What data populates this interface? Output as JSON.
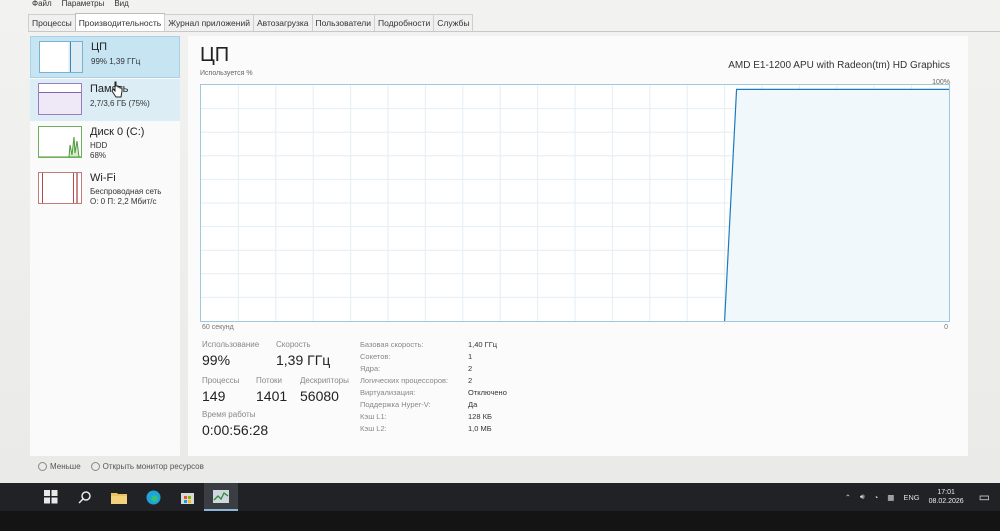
{
  "menu": [
    "Файл",
    "Параметры",
    "Вид"
  ],
  "tabs": [
    "Процессы",
    "Производительность",
    "Журнал приложений",
    "Автозагрузка",
    "Пользователи",
    "Подробности",
    "Службы"
  ],
  "active_tab": "Производительность",
  "sidebar": {
    "items": [
      {
        "title": "ЦП",
        "line1": "99% 1,39 ГГц",
        "line2": ""
      },
      {
        "title": "Память",
        "line1": "2,7/3,6 ГБ (75%)",
        "line2": ""
      },
      {
        "title": "Диск 0 (C:)",
        "line1": "HDD",
        "line2": "68%"
      },
      {
        "title": "Wi-Fi",
        "line1": "Беспроводная сеть",
        "line2": "О: 0 П: 2,2 Мбит/с"
      }
    ]
  },
  "main": {
    "title": "ЦП",
    "model": "AMD E1-1200 APU with Radeon(tm) HD Graphics",
    "usage_label": "Используется %",
    "max_label": "100%",
    "time_label": "60 секунд",
    "zero_label": "0"
  },
  "stats": {
    "usage_label": "Использование",
    "usage_value": "99%",
    "speed_label": "Скорость",
    "speed_value": "1,39 ГГц",
    "processes_label": "Процессы",
    "processes_value": "149",
    "threads_label": "Потоки",
    "threads_value": "1401",
    "handles_label": "Дескрипторы",
    "handles_value": "56080",
    "uptime_label": "Время работы",
    "uptime_value": "0:00:56:28"
  },
  "specs": [
    {
      "label": "Базовая скорость:",
      "value": "1,40 ГГц"
    },
    {
      "label": "Сокетов:",
      "value": "1"
    },
    {
      "label": "Ядра:",
      "value": "2"
    },
    {
      "label": "Логических процессоров:",
      "value": "2"
    },
    {
      "label": "Виртуализация:",
      "value": "Отключено"
    },
    {
      "label": "Поддержка Hyper-V:",
      "value": "Да"
    },
    {
      "label": "Кэш L1:",
      "value": "128 КБ"
    },
    {
      "label": "Кэш L2:",
      "value": "1,0 МБ"
    }
  ],
  "footer": {
    "less": "Меньше",
    "monitor": "Открыть монитор ресурсов"
  },
  "taskbar": {
    "lang": "ENG",
    "time": "17:01",
    "date": "08.02.2026"
  },
  "graph": {
    "cpu_usage_percent": 99,
    "jump_at_fraction": 0.7
  },
  "colors": {
    "accent": "#1c7ac0",
    "selected": "#c6e4f2",
    "taskbar": "#202226"
  }
}
